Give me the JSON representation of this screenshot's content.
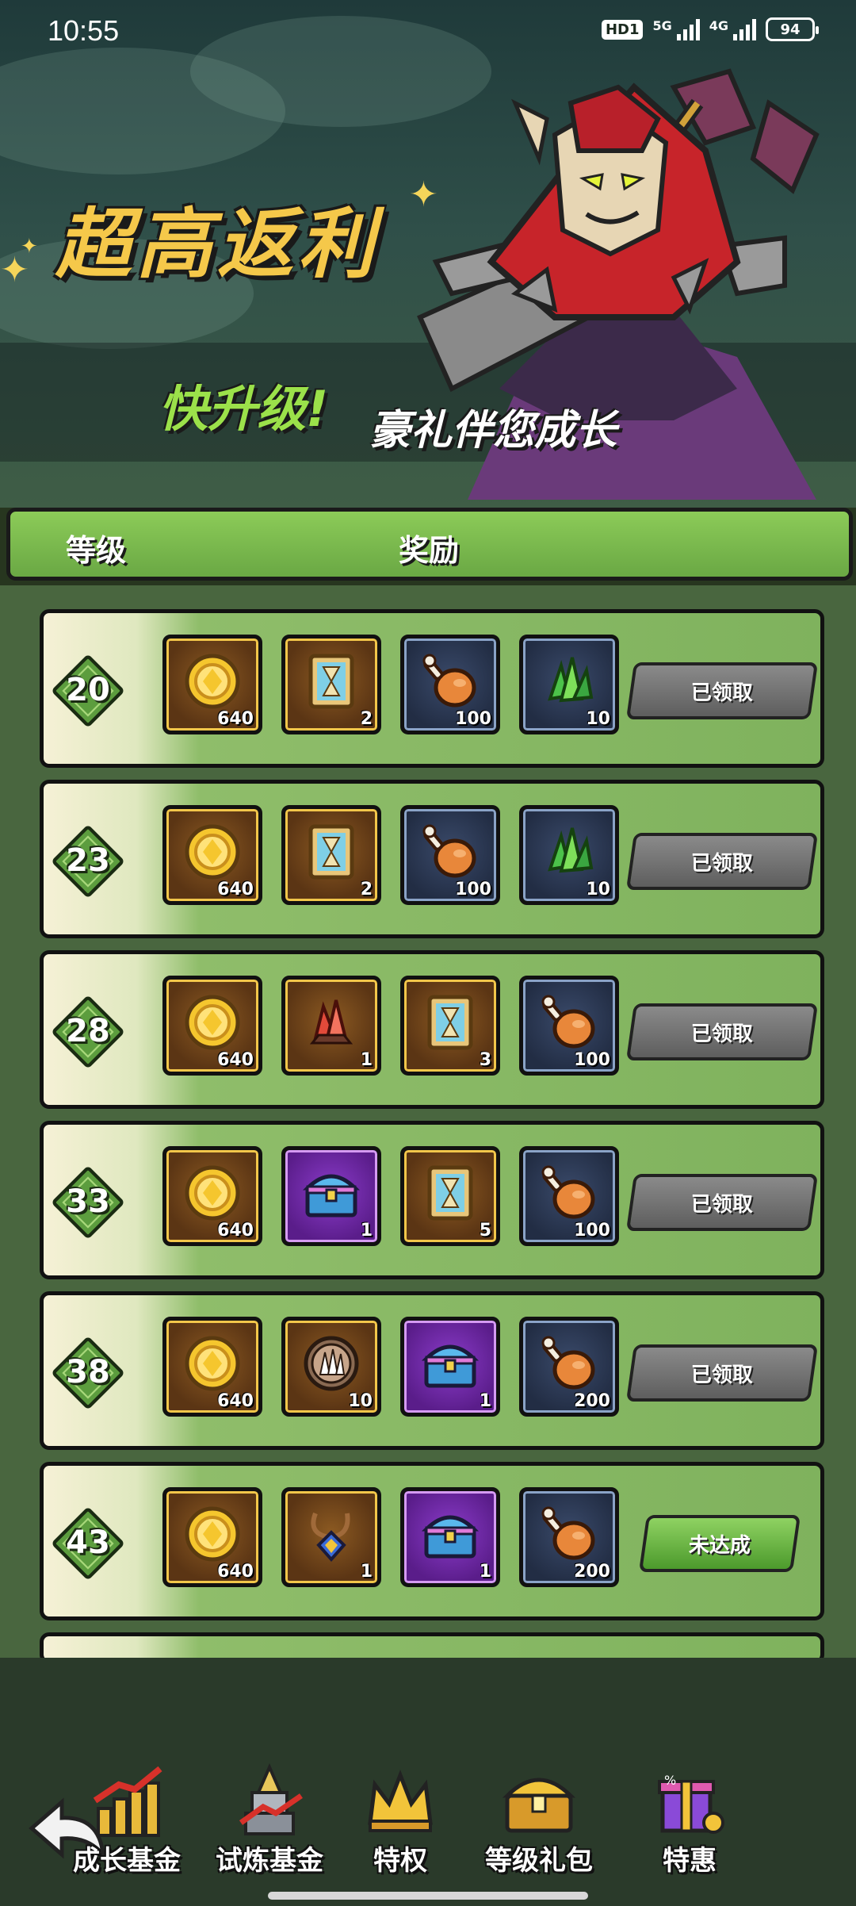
{
  "status_bar": {
    "time": "10:55",
    "hd": "HD1",
    "net1": "5G",
    "net2": "4G",
    "battery": "94"
  },
  "banner": {
    "title": "超高返利",
    "subtitle_1": "快升级!",
    "subtitle_2": "豪礼伴您成长"
  },
  "header": {
    "level_label": "等级",
    "reward_label": "奖励"
  },
  "rows": [
    {
      "level": "20",
      "items": [
        {
          "icon": "gold-coin-icon",
          "frame": "gold",
          "qty": "640"
        },
        {
          "icon": "hourglass-card-icon",
          "frame": "gold",
          "qty": "2"
        },
        {
          "icon": "meat-drumstick-icon",
          "frame": "blue",
          "qty": "100"
        },
        {
          "icon": "green-crystal-icon",
          "frame": "blue",
          "qty": "10"
        }
      ],
      "status": "已领取",
      "status_type": "claimed"
    },
    {
      "level": "23",
      "items": [
        {
          "icon": "gold-coin-icon",
          "frame": "gold",
          "qty": "640"
        },
        {
          "icon": "hourglass-card-icon",
          "frame": "gold",
          "qty": "2"
        },
        {
          "icon": "meat-drumstick-icon",
          "frame": "blue",
          "qty": "100"
        },
        {
          "icon": "green-crystal-icon",
          "frame": "blue",
          "qty": "10"
        }
      ],
      "status": "已领取",
      "status_type": "claimed"
    },
    {
      "level": "28",
      "items": [
        {
          "icon": "gold-coin-icon",
          "frame": "gold",
          "qty": "640"
        },
        {
          "icon": "red-crystal-icon",
          "frame": "gold",
          "qty": "1"
        },
        {
          "icon": "hourglass-card-icon",
          "frame": "gold",
          "qty": "3"
        },
        {
          "icon": "meat-drumstick-icon",
          "frame": "blue",
          "qty": "100"
        }
      ],
      "status": "已领取",
      "status_type": "claimed"
    },
    {
      "level": "33",
      "items": [
        {
          "icon": "gold-coin-icon",
          "frame": "gold",
          "qty": "640"
        },
        {
          "icon": "treasure-chest-icon",
          "frame": "purple",
          "qty": "1"
        },
        {
          "icon": "hourglass-card-icon",
          "frame": "gold",
          "qty": "5"
        },
        {
          "icon": "meat-drumstick-icon",
          "frame": "blue",
          "qty": "100"
        }
      ],
      "status": "已领取",
      "status_type": "claimed"
    },
    {
      "level": "38",
      "items": [
        {
          "icon": "gold-coin-icon",
          "frame": "gold",
          "qty": "640"
        },
        {
          "icon": "spike-medal-icon",
          "frame": "gold",
          "qty": "10"
        },
        {
          "icon": "treasure-chest-icon",
          "frame": "purple",
          "qty": "1"
        },
        {
          "icon": "meat-drumstick-icon",
          "frame": "blue",
          "qty": "200"
        }
      ],
      "status": "已领取",
      "status_type": "claimed"
    },
    {
      "level": "43",
      "items": [
        {
          "icon": "gold-coin-icon",
          "frame": "gold",
          "qty": "640"
        },
        {
          "icon": "amulet-icon",
          "frame": "gold",
          "qty": "1"
        },
        {
          "icon": "treasure-chest-icon",
          "frame": "purple",
          "qty": "1"
        },
        {
          "icon": "meat-drumstick-icon",
          "frame": "blue",
          "qty": "200"
        }
      ],
      "status": "未达成",
      "status_type": "pending"
    }
  ],
  "nav": {
    "items": [
      {
        "label": "成长基金",
        "icon": "growth-fund-icon"
      },
      {
        "label": "试炼基金",
        "icon": "trial-fund-icon"
      },
      {
        "label": "特权",
        "icon": "crown-icon"
      },
      {
        "label": "等级礼包",
        "icon": "level-chest-icon"
      },
      {
        "label": "特惠",
        "icon": "discount-gift-icon"
      }
    ]
  },
  "colors": {
    "accent_green": "#7fb25d",
    "header_green": "#8ccb58",
    "title_gold": "#f5c84a",
    "claimed_gray": "#6e6e6e"
  }
}
